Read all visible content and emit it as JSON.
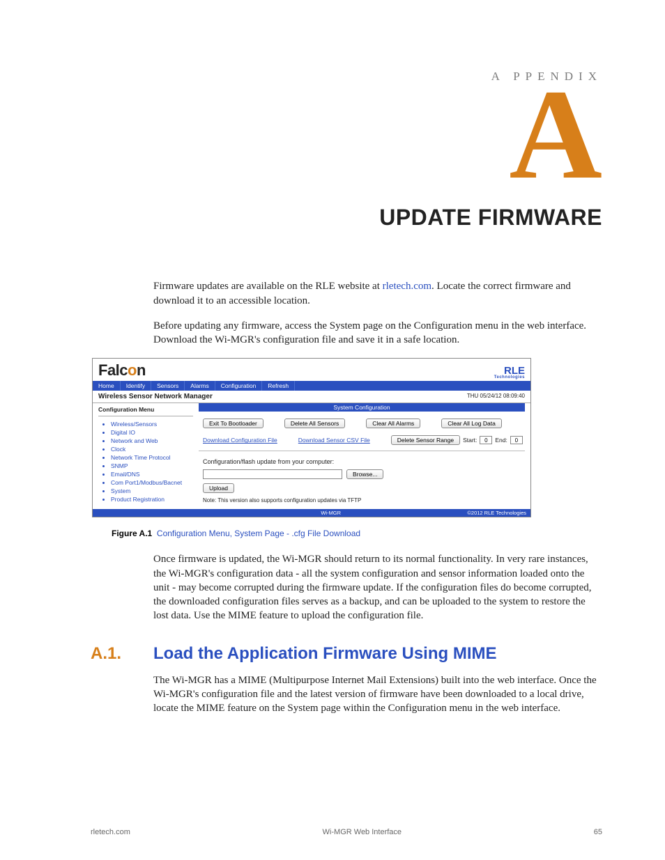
{
  "header": {
    "appendix_label": "A PPENDIX",
    "big_letter": "A",
    "title": "UPDATE FIRMWARE"
  },
  "paragraphs": {
    "p1a": "Firmware updates are available on the RLE website at ",
    "p1_link": "rletech.com",
    "p1b": ". Locate the correct firmware and download it to an accessible location.",
    "p2": "Before updating any firmware, access the System page on the Configuration menu in the web interface. Download the Wi-MGR's configuration file and save it in a safe location.",
    "p3": "Once firmware is updated, the Wi-MGR should return to its normal functionality. In very rare instances, the Wi-MGR's configuration data - all the system configuration and sensor information loaded onto the unit - may become corrupted during the firmware update. If the configuration files do become corrupted, the downloaded configuration files serves as a backup, and can be uploaded to the system to restore the lost data. Use the MIME feature to upload the configuration file.",
    "p4": "The Wi-MGR has a MIME (Multipurpose Internet Mail Extensions) built into the web interface. Once the Wi-MGR's configuration file and the latest version of firmware have been downloaded to a local drive, locate the MIME feature on the System page within the Configuration menu in the web interface."
  },
  "screenshot": {
    "falcon": {
      "pre": "Falc",
      "o": "o",
      "post": "n"
    },
    "rle": {
      "brand": "RLE",
      "sub": "Technologies"
    },
    "tabs": [
      "Home",
      "Identify",
      "Sensors",
      "Alarms",
      "Configuration",
      "Refresh"
    ],
    "wsnm": "Wireless Sensor Network Manager",
    "datetime": "THU 05/24/12 08:09:40",
    "side_title": "Configuration Menu",
    "side_items": [
      "Wireless/Sensors",
      "Digital IO",
      "Network and Web",
      "Clock",
      "Network Time Protocol",
      "SNMP",
      "Email/DNS",
      "Com Port1/Modbus/Bacnet",
      "System",
      "Product Registration"
    ],
    "section_title": "System Configuration",
    "buttons": {
      "exit": "Exit To Bootloader",
      "del_sensors": "Delete All Sensors",
      "clear_alarms": "Clear All Alarms",
      "clear_log": "Clear All Log Data",
      "dl_cfg": "Download Configuration File",
      "dl_csv": "Download Sensor CSV File",
      "del_range": "Delete Sensor Range",
      "start_label": "Start:",
      "start_val": "0",
      "end_label": "End:",
      "end_val": "0",
      "upload_label": "Configuration/flash update from your computer:",
      "browse": "Browse...",
      "upload": "Upload",
      "note": "Note: This version also supports configuration updates via TFTP"
    },
    "footer_mid": "Wi-MGR",
    "footer_right": "©2012 RLE Technologies"
  },
  "figure": {
    "id": "Figure A.1",
    "caption": "Configuration Menu, System Page - .cfg File Download"
  },
  "section": {
    "num": "A.1.",
    "title": "Load the Application Firmware Using MIME"
  },
  "footer": {
    "left": "rletech.com",
    "center": "Wi-MGR Web Interface",
    "right": "65"
  }
}
